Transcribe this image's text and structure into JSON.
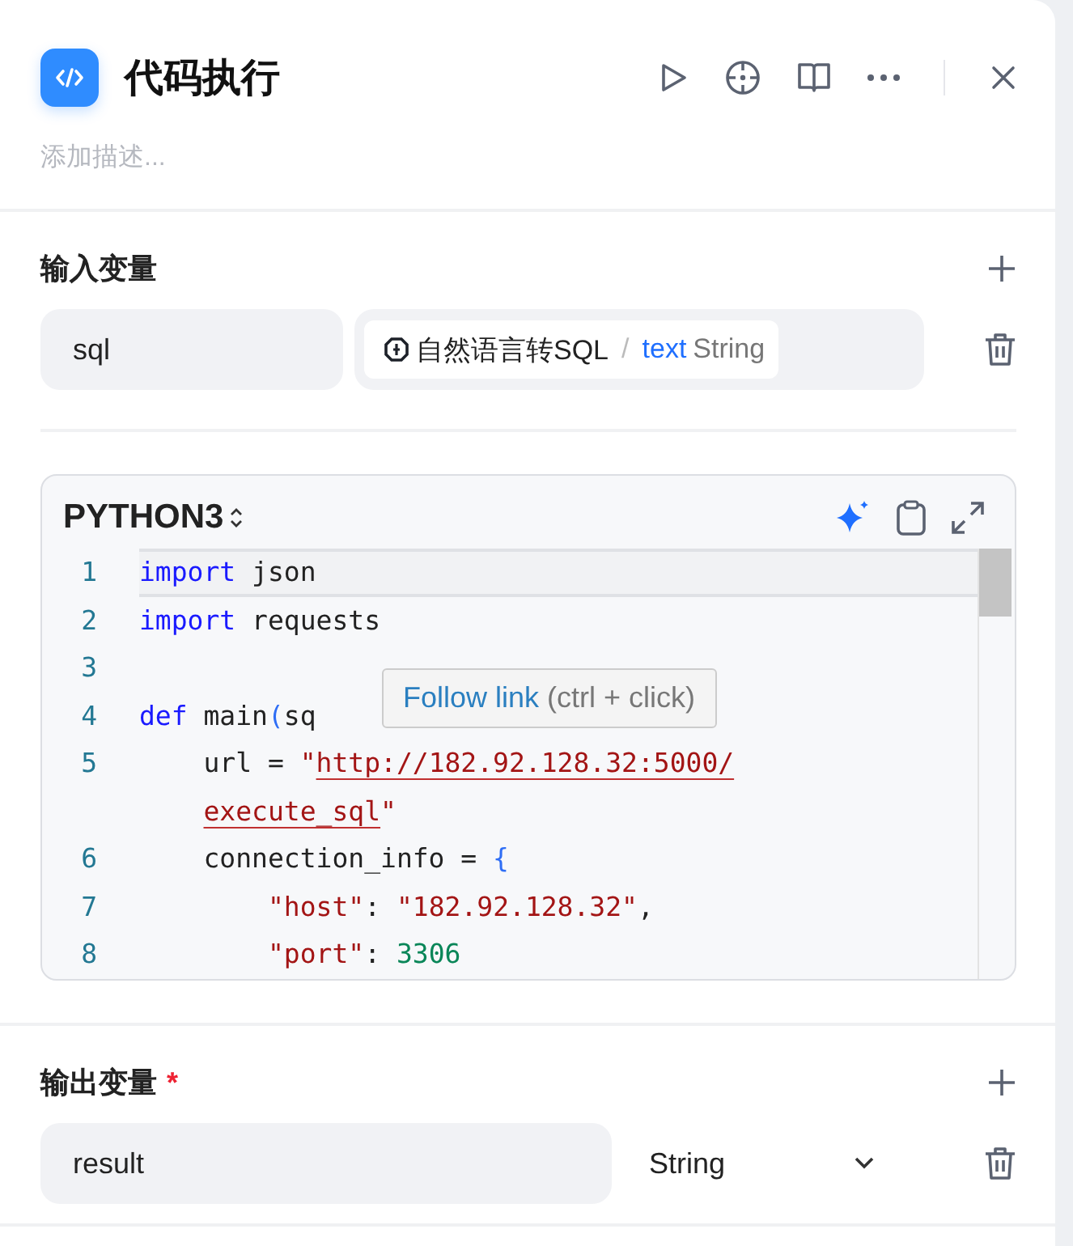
{
  "node": {
    "title": "代码执行",
    "description_placeholder": "添加描述..."
  },
  "input_variables": {
    "title": "输入变量",
    "items": [
      {
        "name": "sql",
        "source": "自然语言转SQL",
        "separator": "/",
        "field": "text",
        "type": "String"
      }
    ]
  },
  "code_editor": {
    "language": "PYTHON3",
    "lines": [
      {
        "number": "1",
        "current": true,
        "rows": [
          [
            {
              "kind": "keyword",
              "text": "import"
            },
            {
              "kind": "plain",
              "text": " json"
            }
          ]
        ]
      },
      {
        "number": "2",
        "current": false,
        "rows": [
          [
            {
              "kind": "keyword",
              "text": "import"
            },
            {
              "kind": "plain",
              "text": " requests"
            }
          ]
        ]
      },
      {
        "number": "3",
        "current": false,
        "rows": [
          []
        ]
      },
      {
        "number": "4",
        "current": false,
        "rows": [
          [
            {
              "kind": "keyword",
              "text": "def"
            },
            {
              "kind": "plain",
              "text": " main"
            },
            {
              "kind": "punct",
              "text": "("
            },
            {
              "kind": "plain",
              "text": "sq"
            }
          ]
        ]
      },
      {
        "number": "5",
        "current": false,
        "rows": [
          [
            {
              "kind": "plain",
              "text": "    url = "
            },
            {
              "kind": "string",
              "text": "\""
            },
            {
              "kind": "link",
              "text": "http://182.92.128.32:5000/"
            }
          ],
          [
            {
              "kind": "plain",
              "text": "    "
            },
            {
              "kind": "link",
              "text": "execute_sql"
            },
            {
              "kind": "string",
              "text": "\""
            }
          ]
        ]
      },
      {
        "number": "6",
        "current": false,
        "rows": [
          [
            {
              "kind": "plain",
              "text": "    connection_info = "
            },
            {
              "kind": "punct",
              "text": "{"
            }
          ]
        ]
      },
      {
        "number": "7",
        "current": false,
        "rows": [
          [
            {
              "kind": "plain",
              "text": "        "
            },
            {
              "kind": "string",
              "text": "\"host\""
            },
            {
              "kind": "plain",
              "text": ": "
            },
            {
              "kind": "string",
              "text": "\"182.92.128.32\""
            },
            {
              "kind": "plain",
              "text": ","
            }
          ]
        ]
      },
      {
        "number": "8",
        "current": false,
        "rows": [
          [
            {
              "kind": "plain",
              "text": "        "
            },
            {
              "kind": "string",
              "text": "\"port\""
            },
            {
              "kind": "plain",
              "text": ": "
            },
            {
              "kind": "number",
              "text": "3306"
            }
          ]
        ]
      }
    ],
    "tooltip": {
      "action": "Follow link",
      "hint": "(ctrl + click)"
    }
  },
  "output_variables": {
    "title": "输出变量",
    "required_mark": "*",
    "items": [
      {
        "name": "result",
        "type": "String"
      }
    ]
  }
}
